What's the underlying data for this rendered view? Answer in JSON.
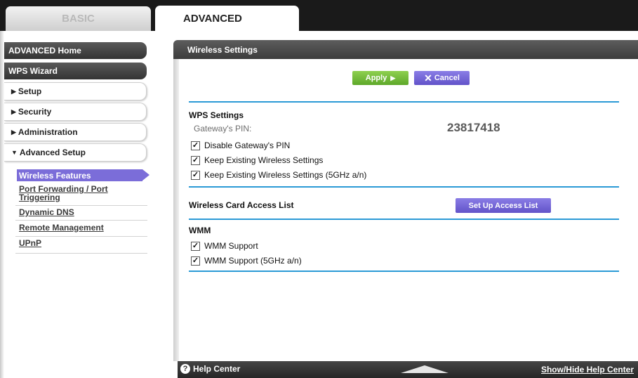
{
  "tabs": {
    "basic": "BASIC",
    "advanced": "ADVANCED"
  },
  "sidebar": {
    "advanced_home": "ADVANCED Home",
    "wps_wizard": "WPS Wizard",
    "setup": "Setup",
    "security": "Security",
    "administration": "Administration",
    "advanced_setup": "Advanced Setup",
    "submenu": {
      "wireless_features": "Wireless Features",
      "port_forwarding_line1": "Port Forwarding / Port",
      "port_forwarding_line2": "Triggering",
      "dynamic_dns": "Dynamic DNS",
      "remote_management": "Remote Management",
      "upnp": "UPnP"
    }
  },
  "panel": {
    "title": "Wireless Settings",
    "apply_label": "Apply",
    "cancel_label": "Cancel",
    "wps": {
      "title": "WPS Settings",
      "pin_label": "Gateway's PIN:",
      "pin_value": "23817418",
      "options": [
        {
          "label": "Disable Gateway's PIN",
          "checked": true
        },
        {
          "label": "Keep Existing Wireless Settings",
          "checked": true
        },
        {
          "label": "Keep Existing Wireless Settings (5GHz a/n)",
          "checked": true
        }
      ]
    },
    "access_list": {
      "title": "Wireless Card Access List",
      "button_label": "Set Up Access List"
    },
    "wmm": {
      "title": "WMM",
      "options": [
        {
          "label": "WMM Support",
          "checked": true
        },
        {
          "label": "WMM Support (5GHz a/n)",
          "checked": true
        }
      ]
    }
  },
  "help": {
    "help_center": "Help Center",
    "show_hide": "Show/Hide Help Center"
  },
  "colors": {
    "accent_blue": "#2b9ad6",
    "apply_green": "#6cb536",
    "purple": "#7b6dd9"
  }
}
